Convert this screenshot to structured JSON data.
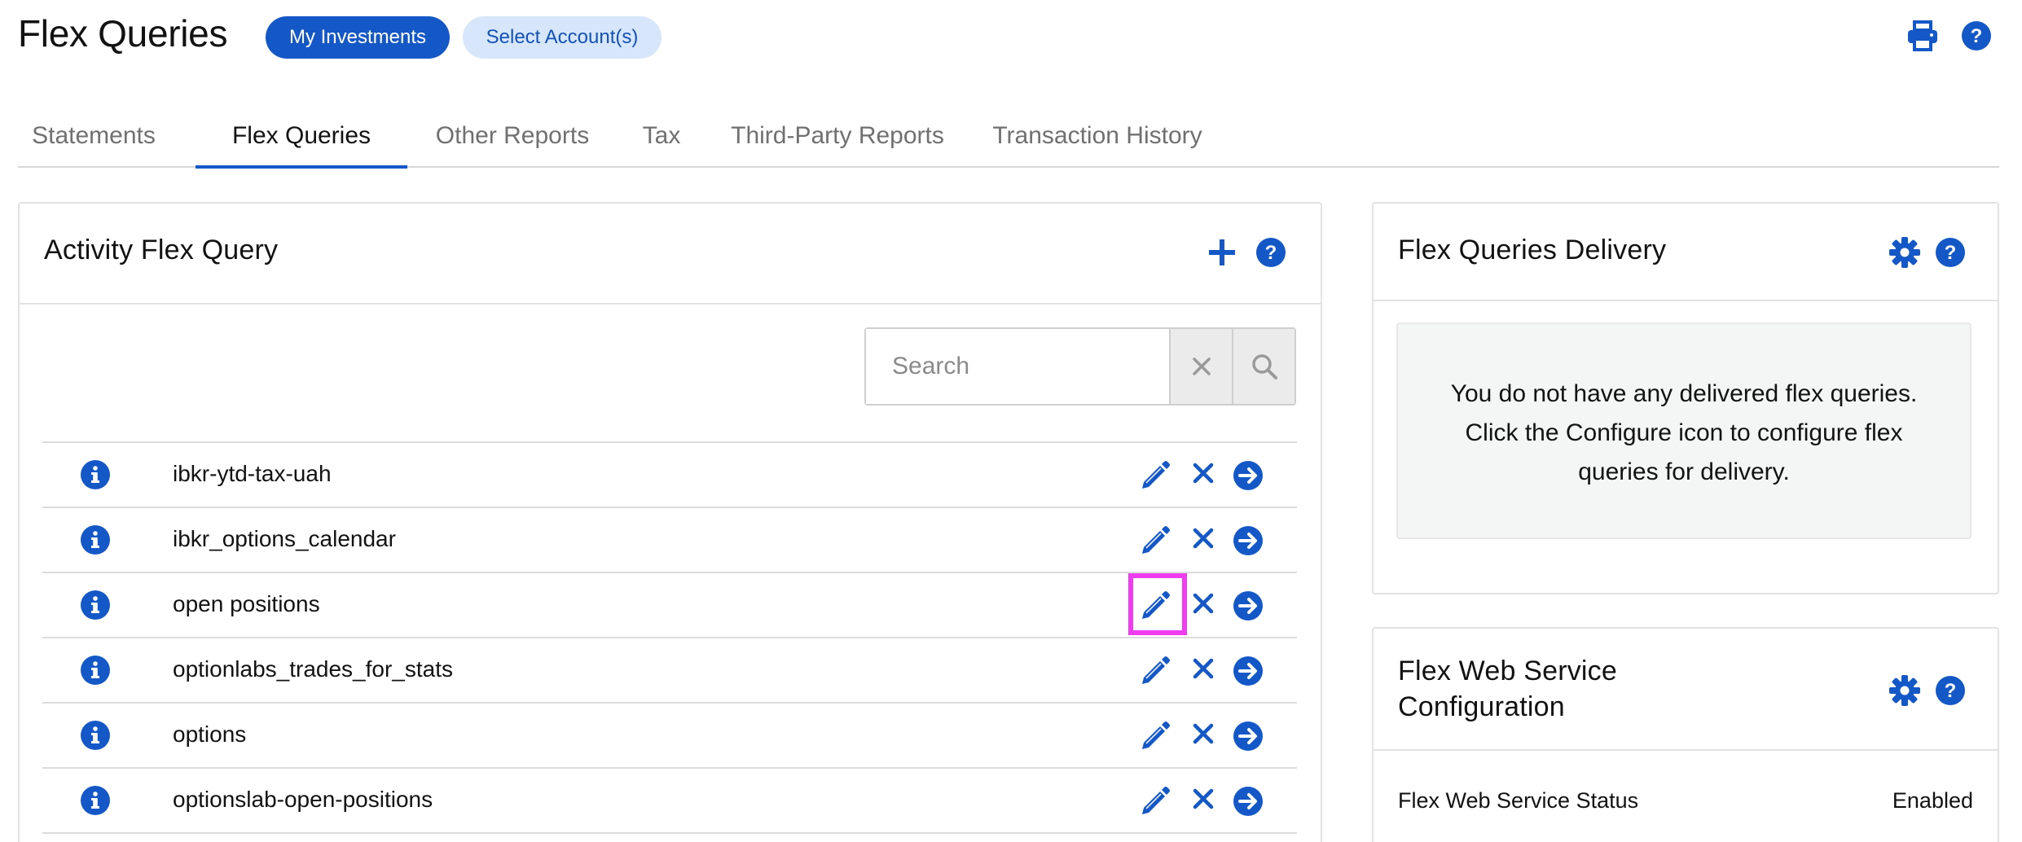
{
  "header": {
    "title": "Flex Queries",
    "my_investments": "My Investments",
    "select_accounts": "Select Account(s)"
  },
  "tabs": [
    {
      "label": "Statements"
    },
    {
      "label": "Flex Queries"
    },
    {
      "label": "Other Reports"
    },
    {
      "label": "Tax"
    },
    {
      "label": "Third-Party Reports"
    },
    {
      "label": "Transaction History"
    }
  ],
  "activity_panel": {
    "title": "Activity Flex Query",
    "search_placeholder": "Search",
    "rows": [
      {
        "name": "ibkr-ytd-tax-uah"
      },
      {
        "name": "ibkr_options_calendar"
      },
      {
        "name": "open positions"
      },
      {
        "name": "optionlabs_trades_for_stats"
      },
      {
        "name": "options"
      },
      {
        "name": "optionslab-open-positions"
      }
    ]
  },
  "delivery_panel": {
    "title": "Flex Queries Delivery",
    "message": "You do not have any delivered flex queries. Click the Configure icon to configure flex queries for delivery."
  },
  "web_service_panel": {
    "title_line1": "Flex Web Service",
    "title_line2": "Configuration",
    "status_label": "Flex Web Service Status",
    "status_value": "Enabled"
  },
  "colors": {
    "accent": "#1458c8",
    "highlight": "#f03cf0"
  }
}
